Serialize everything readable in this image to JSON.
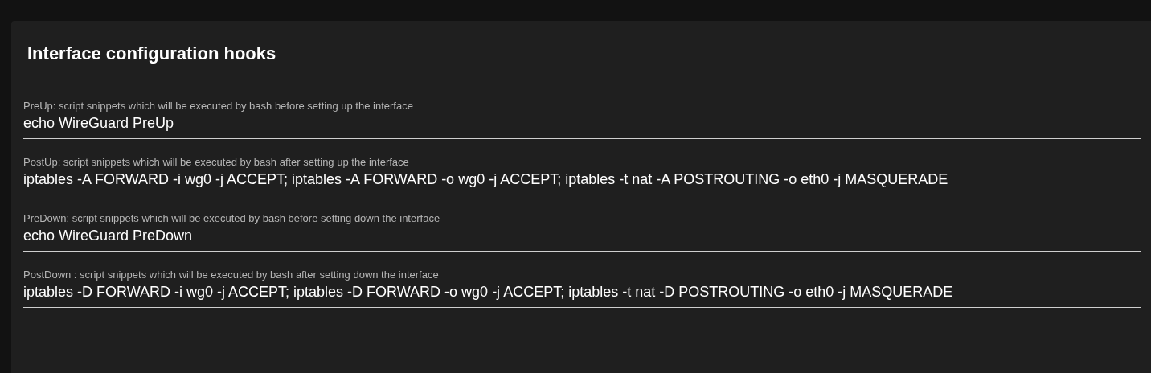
{
  "card": {
    "title": "Interface configuration hooks",
    "fields": [
      {
        "label": "PreUp: script snippets which will be executed by bash before setting up the interface",
        "value": "echo WireGuard PreUp"
      },
      {
        "label": "PostUp: script snippets which will be executed by bash after setting up the interface",
        "value": "iptables -A FORWARD -i wg0 -j ACCEPT; iptables -A FORWARD -o wg0 -j ACCEPT; iptables -t nat -A POSTROUTING -o eth0 -j MASQUERADE"
      },
      {
        "label": "PreDown: script snippets which will be executed by bash before setting down the interface",
        "value": "echo WireGuard PreDown"
      },
      {
        "label": "PostDown : script snippets which will be executed by bash after setting down the interface",
        "value": "iptables -D FORWARD -i wg0 -j ACCEPT; iptables -D FORWARD -o wg0 -j ACCEPT; iptables -t nat -D POSTROUTING -o eth0 -j MASQUERADE"
      }
    ]
  }
}
